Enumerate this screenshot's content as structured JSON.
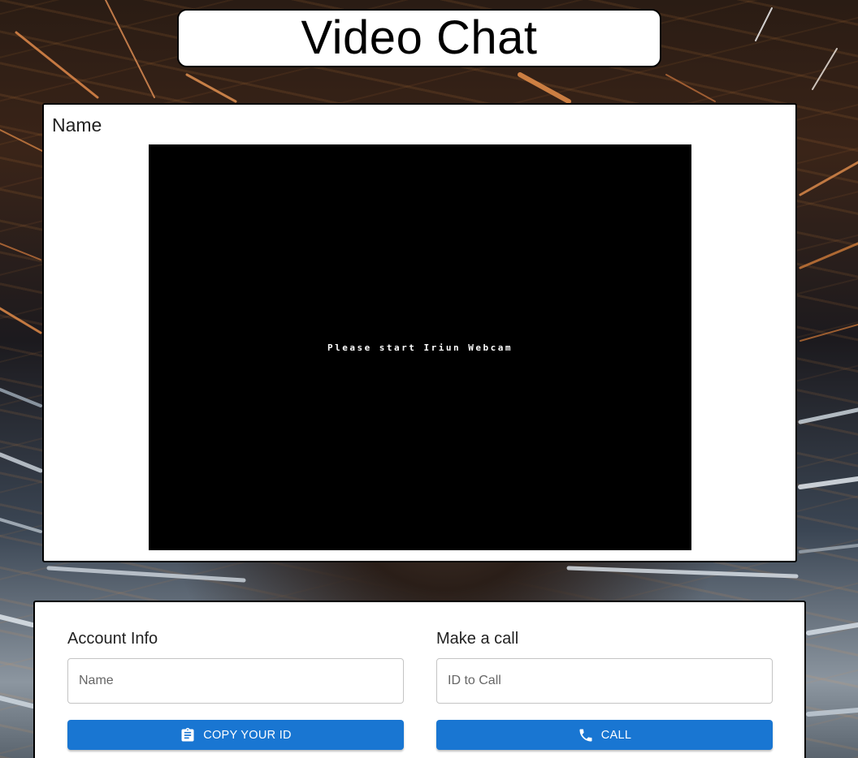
{
  "app": {
    "title": "Video Chat"
  },
  "video": {
    "name_label": "Name",
    "placeholder_message": "Please start Iriun Webcam"
  },
  "account_info": {
    "heading": "Account Info",
    "name_placeholder": "Name",
    "copy_button_label": "COPY YOUR ID",
    "copy_button_icon": "clipboard-icon"
  },
  "make_call": {
    "heading": "Make a call",
    "id_placeholder": "ID to Call",
    "call_button_label": "CALL",
    "call_button_icon": "phone-icon"
  },
  "colors": {
    "primary_button": "#1976d2",
    "video_background": "#000000",
    "card_background": "#ffffff"
  }
}
